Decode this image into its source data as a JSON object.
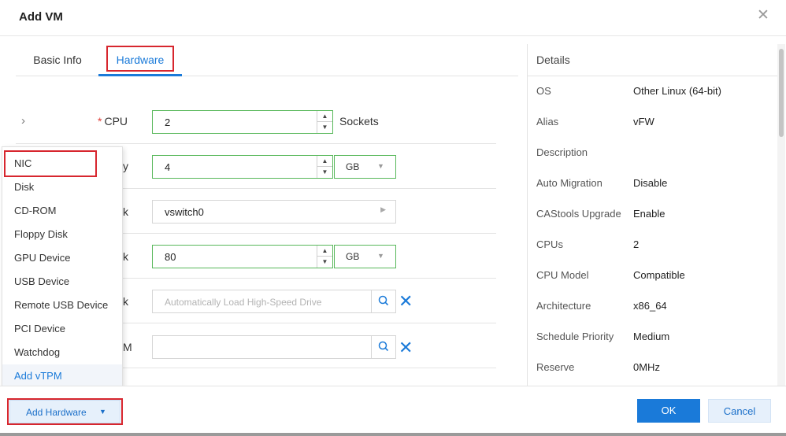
{
  "dialog": {
    "title": "Add VM",
    "close_glyph": "✕"
  },
  "tabs": [
    {
      "label": "Basic Info",
      "active": false
    },
    {
      "label": "Hardware",
      "active": true
    }
  ],
  "form": {
    "expand_glyph": "›",
    "required_mark": "*",
    "cpu": {
      "label": "CPU",
      "value": "2",
      "unit": "Sockets"
    },
    "memory": {
      "label_visible": "y",
      "value": "4",
      "unit": "GB"
    },
    "network": {
      "label_visible": "k",
      "value": "vswitch0"
    },
    "disk": {
      "label_visible": "k",
      "value": "80",
      "unit": "GB"
    },
    "driver_disk": {
      "label_visible": "k",
      "placeholder": "Automatically Load High-Speed Drive"
    },
    "cdrom": {
      "label_visible": "M",
      "value": ""
    }
  },
  "details": {
    "heading": "Details",
    "rows": [
      {
        "key": "OS",
        "value": "Other Linux (64-bit)"
      },
      {
        "key": "Alias",
        "value": "vFW"
      },
      {
        "key": "Description",
        "value": ""
      },
      {
        "key": "Auto Migration",
        "value": "Disable"
      },
      {
        "key": "CAStools Upgrade",
        "value": "Enable"
      },
      {
        "key": "CPUs",
        "value": "2"
      },
      {
        "key": "CPU Model",
        "value": "Compatible"
      },
      {
        "key": "Architecture",
        "value": "x86_64"
      },
      {
        "key": "Schedule Priority",
        "value": "Medium"
      },
      {
        "key": "Reserve",
        "value": "0MHz"
      }
    ]
  },
  "hardware_menu": {
    "items": [
      "NIC",
      "Disk",
      "CD-ROM",
      "Floppy Disk",
      "GPU Device",
      "USB Device",
      "Remote USB Device",
      "PCI Device",
      "Watchdog",
      "Add vTPM"
    ],
    "active_index": 9
  },
  "footer": {
    "add_hardware_label": "Add Hardware",
    "ok_label": "OK",
    "cancel_label": "Cancel"
  },
  "colors": {
    "accent": "#1a7ad9",
    "highlight": "#d7262e",
    "valid_border": "#58b85a"
  },
  "icons": {
    "search": "search-icon",
    "clear": "clear-icon",
    "close": "close-icon"
  }
}
